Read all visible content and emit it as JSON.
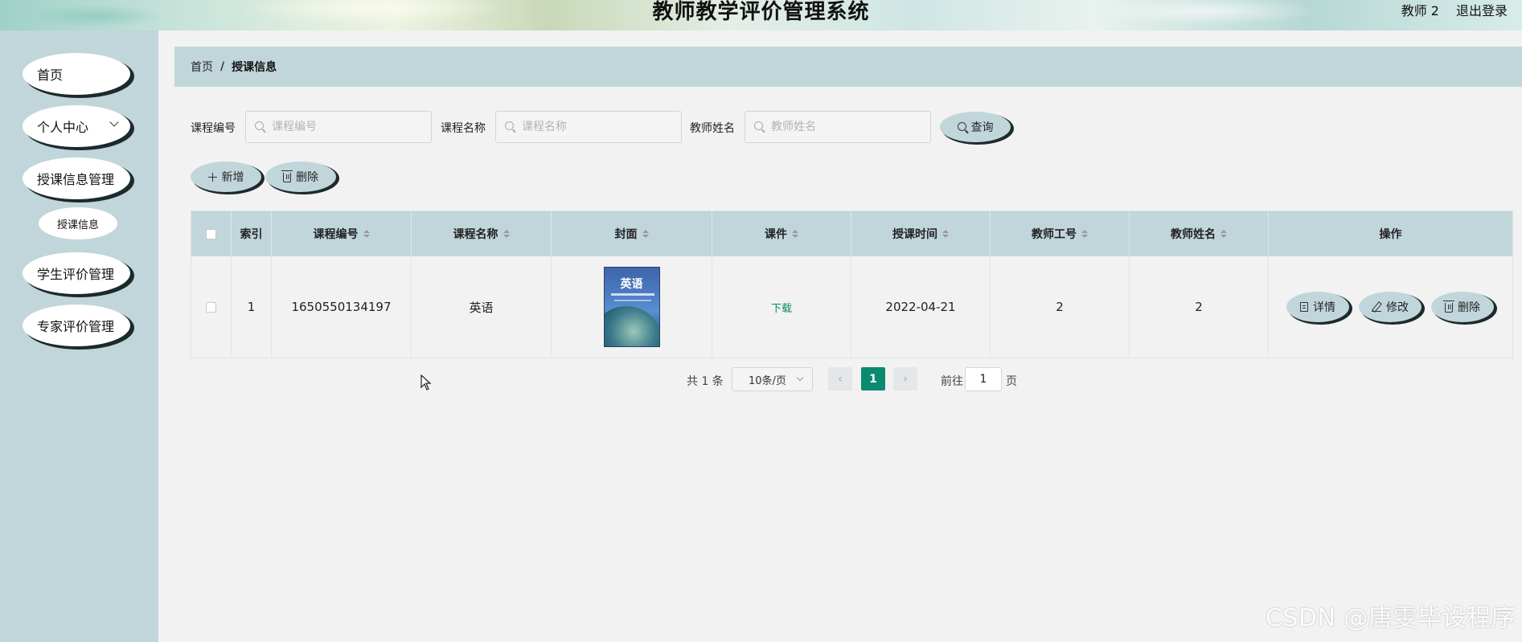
{
  "header": {
    "title": "教师教学评价管理系统",
    "user": "教师 2",
    "logout": "退出登录"
  },
  "sidebar": {
    "items": [
      {
        "label": "首页"
      },
      {
        "label": "个人中心"
      },
      {
        "label": "授课信息管理"
      },
      {
        "label": "学生评价管理"
      },
      {
        "label": "专家评价管理"
      }
    ],
    "sub_item": "授课信息"
  },
  "breadcrumb": {
    "home": "首页",
    "separator": "/",
    "current": "授课信息"
  },
  "search": {
    "course_no_label": "课程编号",
    "course_no_placeholder": "课程编号",
    "course_name_label": "课程名称",
    "course_name_placeholder": "课程名称",
    "teacher_name_label": "教师姓名",
    "teacher_name_placeholder": "教师姓名",
    "query_button": "查询"
  },
  "actions": {
    "add_button": "新增",
    "delete_button": "删除"
  },
  "table": {
    "columns": [
      "索引",
      "课程编号",
      "课程名称",
      "封面",
      "课件",
      "授课时间",
      "教师工号",
      "教师姓名",
      "操作"
    ],
    "rows": [
      {
        "index": "1",
        "course_no": "1650550134197",
        "course_name": "英语",
        "cover_title": "英语",
        "courseware": "下载",
        "teaching_time": "2022-04-21",
        "teacher_no": "2",
        "teacher_name": "2",
        "ops": {
          "detail": "详情",
          "edit": "修改",
          "delete": "删除"
        }
      }
    ]
  },
  "pagination": {
    "total": "共 1 条",
    "page_size": "10条/页",
    "current_page": "1",
    "goto_label": "前往",
    "goto_value": "1",
    "page_suffix": "页"
  },
  "watermark": "CSDN @唐雯毕设程序"
}
